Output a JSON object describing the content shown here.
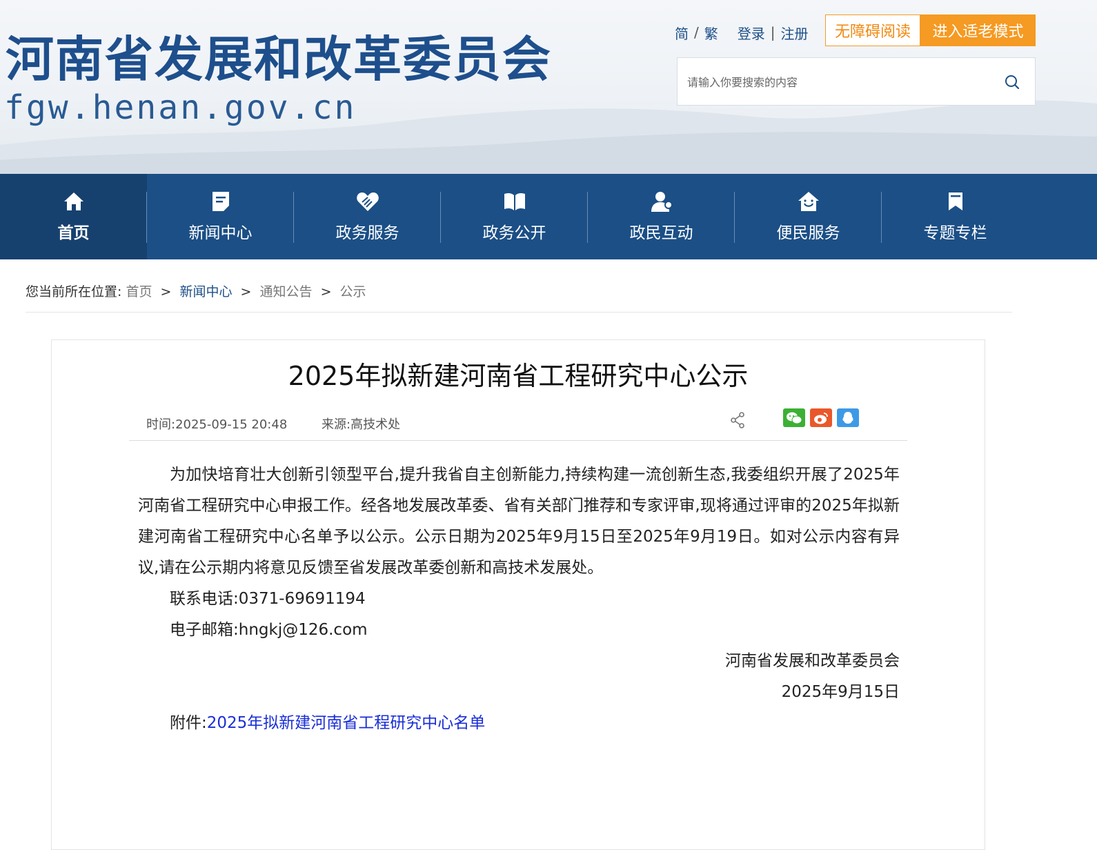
{
  "header": {
    "site_title": "河南省发展和改革委员会",
    "site_domain": "fgw.henan.gov.cn",
    "lang_simplified": "简",
    "lang_separator": "/",
    "lang_traditional": "繁",
    "login": "登录",
    "login_separator": "|",
    "register": "注册",
    "accessible_reading": "无障碍阅读",
    "elder_mode": "进入适老模式",
    "search_placeholder": "请输入你要搜索的内容"
  },
  "nav": {
    "items": [
      {
        "label": "首页",
        "icon": "home-icon",
        "active": true
      },
      {
        "label": "新闻中心",
        "icon": "news-icon"
      },
      {
        "label": "政务服务",
        "icon": "service-icon"
      },
      {
        "label": "政务公开",
        "icon": "book-icon"
      },
      {
        "label": "政民互动",
        "icon": "user-icon"
      },
      {
        "label": "便民服务",
        "icon": "house-icon"
      },
      {
        "label": "专题专栏",
        "icon": "bookmark-icon"
      }
    ]
  },
  "breadcrumb": {
    "prefix": "您当前所在位置:",
    "items": [
      "首页",
      "新闻中心",
      "通知公告",
      "公示"
    ],
    "separator": ">"
  },
  "article": {
    "title": "2025年拟新建河南省工程研究中心公示",
    "time": "时间:2025-09-15 20:48",
    "source": "来源:高技术处",
    "paragraph": "为加快培育壮大创新引领型平台,提升我省自主创新能力,持续构建一流创新生态,我委组织开展了2025年河南省工程研究中心申报工作。经各地发展改革委、省有关部门推荐和专家评审,现将通过评审的2025年拟新建河南省工程研究中心名单予以公示。公示日期为2025年9月15日至2025年9月19日。如对公示内容有异议,请在公示期内将意见反馈至省发展改革委创新和高技术发展处。",
    "phone": "联系电话:0371-69691194",
    "email": "电子邮箱:hngkj@126.com",
    "signature": "河南省发展和改革委员会",
    "date": "2025年9月15日",
    "attachment_label": "附件:",
    "attachment_link": "2025年拟新建河南省工程研究中心名单"
  },
  "colors": {
    "nav_bg": "#1b4f86",
    "nav_active": "#16416f",
    "title_blue": "#1e4f8c",
    "orange": "#f59a22",
    "link_blue": "#1a2ed6"
  }
}
